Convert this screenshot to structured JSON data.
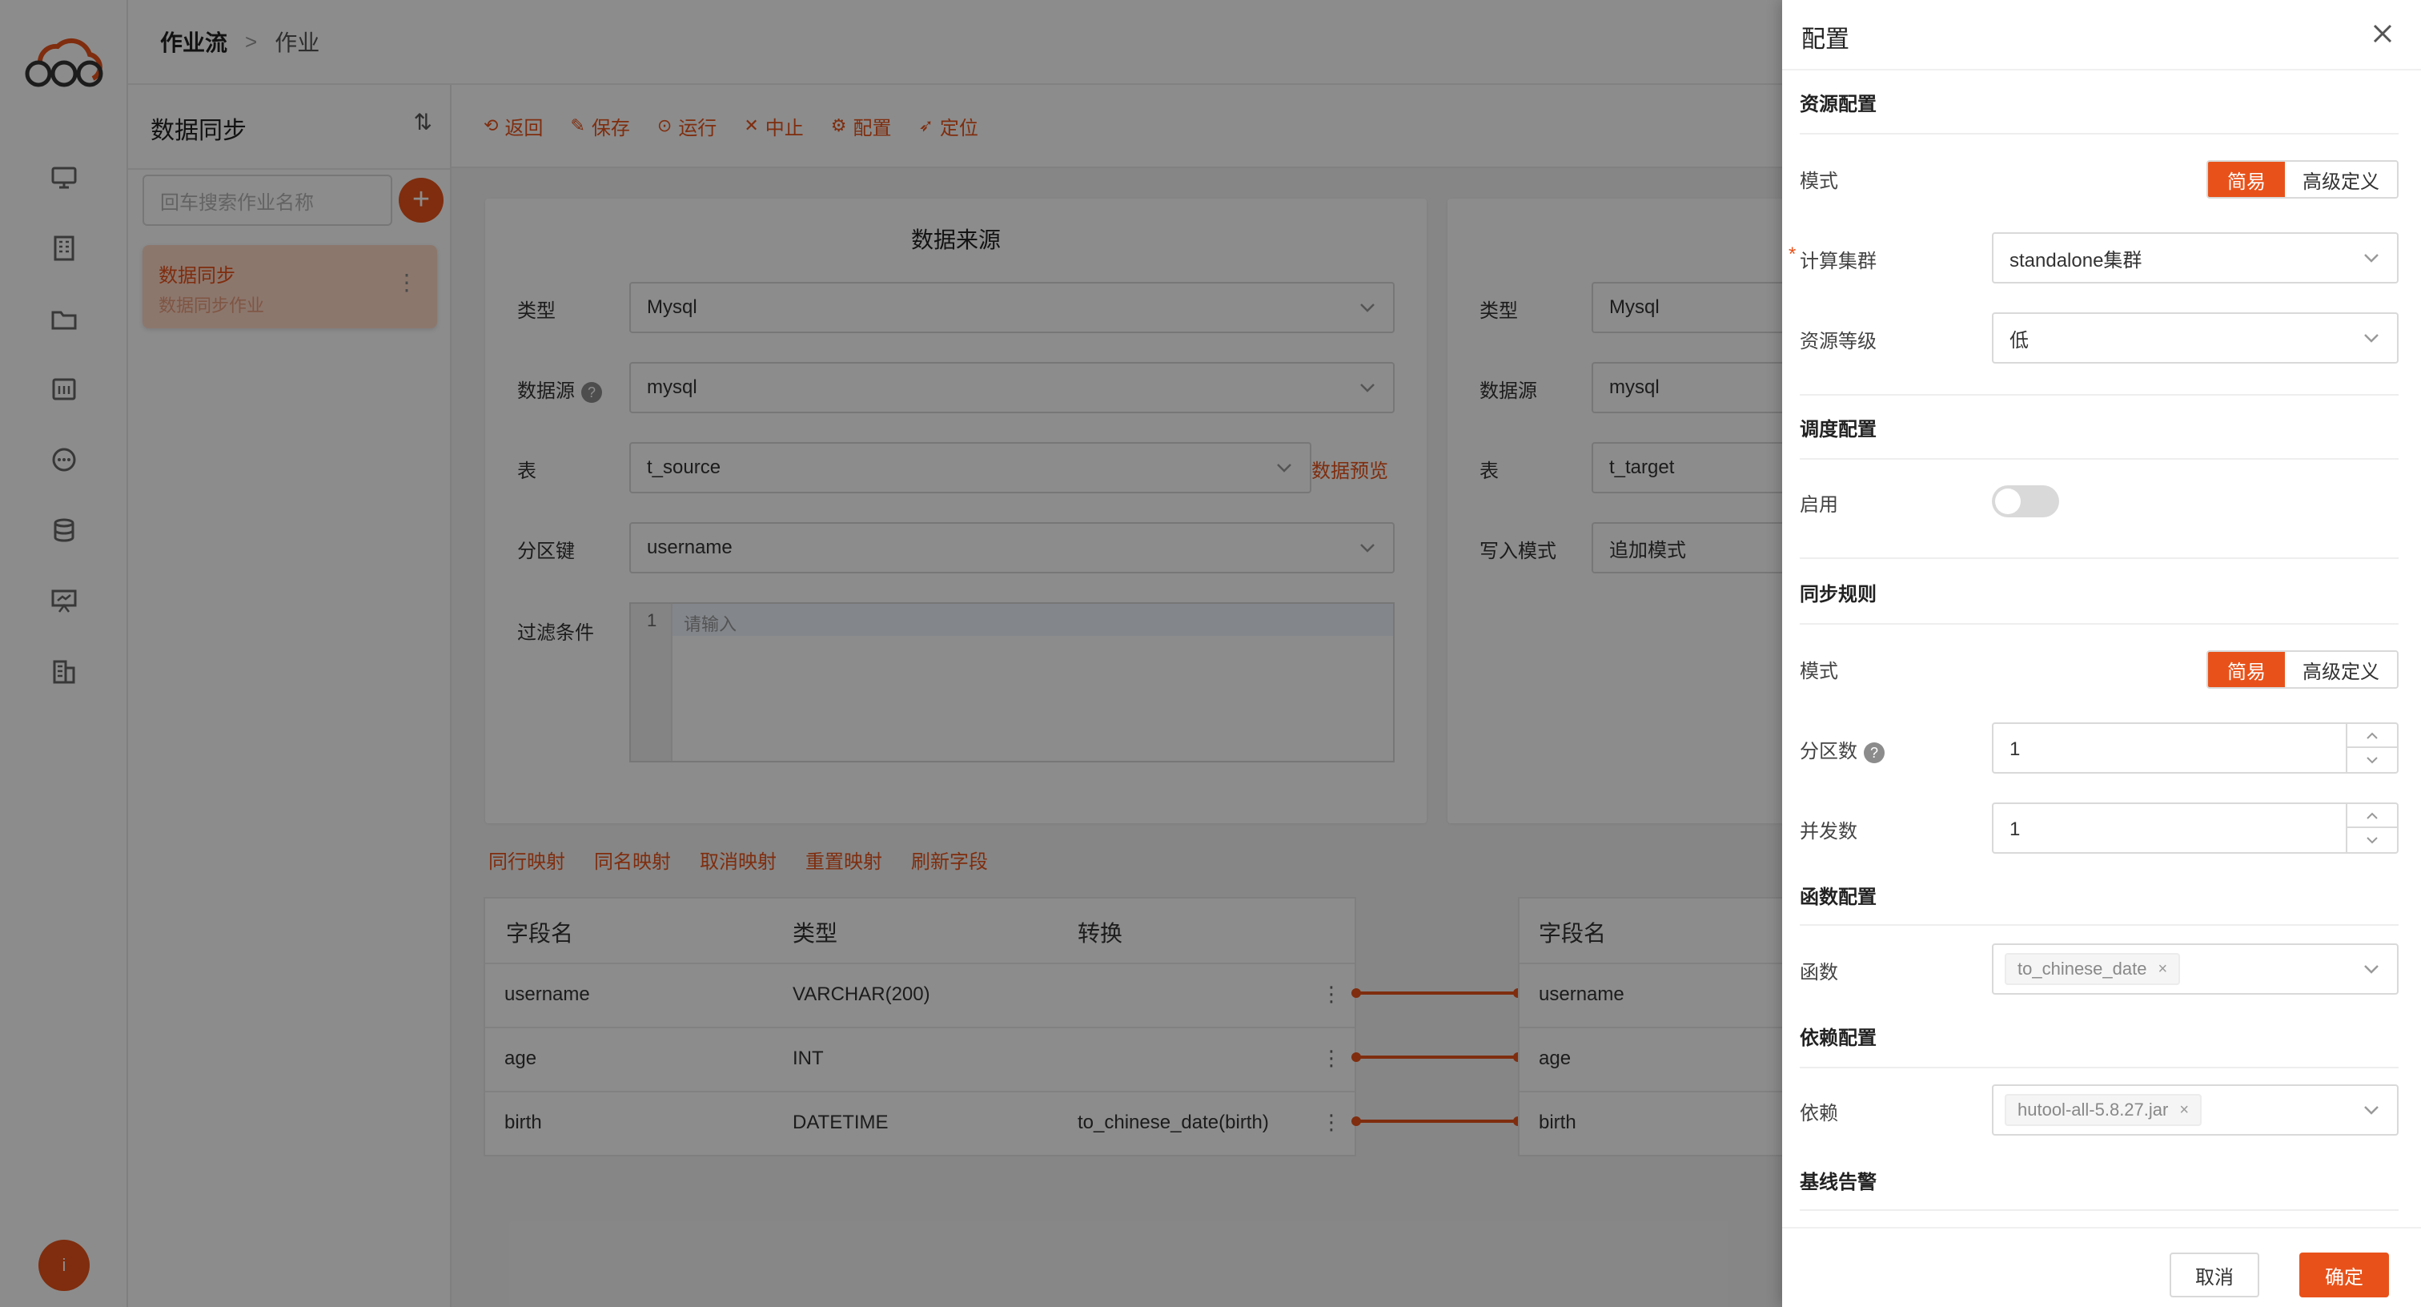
{
  "colors": {
    "accent": "#e8521a",
    "mask": "rgba(0,0,0,0.45)"
  },
  "nav": {
    "logo_icon": "cloud-logo-icon",
    "icons": [
      "monitor-icon",
      "building-icon",
      "folder-icon",
      "dashboard-icon",
      "chat-icon",
      "database-icon",
      "presentation-icon",
      "office-icon"
    ],
    "avatar_text": "i"
  },
  "breadcrumb": {
    "root": "作业流",
    "separator": ">",
    "current": "作业"
  },
  "left_panel": {
    "title": "数据同步",
    "sort_icon": "sort-icon",
    "search_placeholder": "回车搜索作业名称",
    "add_label": "+",
    "jobs": [
      {
        "name": "数据同步",
        "desc": "数据同步作业",
        "more": "⋮"
      }
    ]
  },
  "toolbar": {
    "items": [
      {
        "icon": "⟲",
        "label": "返回"
      },
      {
        "icon": "✎",
        "label": "保存"
      },
      {
        "icon": "⊙",
        "label": "运行"
      },
      {
        "icon": "✕",
        "label": "中止"
      },
      {
        "icon": "⚙",
        "label": "配置"
      },
      {
        "icon": "➶",
        "label": "定位"
      }
    ]
  },
  "source": {
    "title": "数据来源",
    "type_label": "类型",
    "type_value": "Mysql",
    "ds_label": "数据源",
    "ds_value": "mysql",
    "table_label": "表",
    "table_value": "t_source",
    "preview_link": "数据预览",
    "partition_label": "分区键",
    "partition_value": "username",
    "filter_label": "过滤条件",
    "filter_line": "1",
    "filter_placeholder": "请输入"
  },
  "target": {
    "type_label": "类型",
    "type_value": "Mysql",
    "ds_label": "数据源",
    "ds_value": "mysql",
    "table_label": "表",
    "table_value": "t_target",
    "mode_label": "写入模式",
    "mode_value": "追加模式"
  },
  "mapping_actions": [
    "同行映射",
    "同名映射",
    "取消映射",
    "重置映射",
    "刷新字段"
  ],
  "source_fields": {
    "headers": [
      "字段名",
      "类型",
      "转换"
    ],
    "rows": [
      {
        "name": "username",
        "type": "VARCHAR(200)",
        "transform": ""
      },
      {
        "name": "age",
        "type": "INT",
        "transform": ""
      },
      {
        "name": "birth",
        "type": "DATETIME",
        "transform": "to_chinese_date(birth)"
      }
    ]
  },
  "target_fields": {
    "header": "字段名",
    "rows": [
      "username",
      "age",
      "birth"
    ]
  },
  "drawer": {
    "title": "配置",
    "close_icon": "close-icon",
    "resource": {
      "section": "资源配置",
      "mode_label": "模式",
      "mode_simple": "简易",
      "mode_advanced": "高级定义",
      "cluster_label": "计算集群",
      "cluster_required": "*",
      "cluster_value": "standalone集群",
      "level_label": "资源等级",
      "level_value": "低"
    },
    "schedule": {
      "section": "调度配置",
      "enable_label": "启用",
      "enabled": false
    },
    "sync": {
      "section": "同步规则",
      "mode_label": "模式",
      "mode_simple": "简易",
      "mode_advanced": "高级定义",
      "partitions_label": "分区数",
      "partitions_value": "1",
      "concurrency_label": "并发数",
      "concurrency_value": "1"
    },
    "func": {
      "section": "函数配置",
      "label": "函数",
      "tag": "to_chinese_date",
      "tag_close": "×"
    },
    "deps": {
      "section": "依赖配置",
      "label": "依赖",
      "tag": "hutool-all-5.8.27.jar",
      "tag_close": "×"
    },
    "alarm": {
      "section": "基线告警"
    },
    "cancel_label": "取消",
    "ok_label": "确定"
  }
}
